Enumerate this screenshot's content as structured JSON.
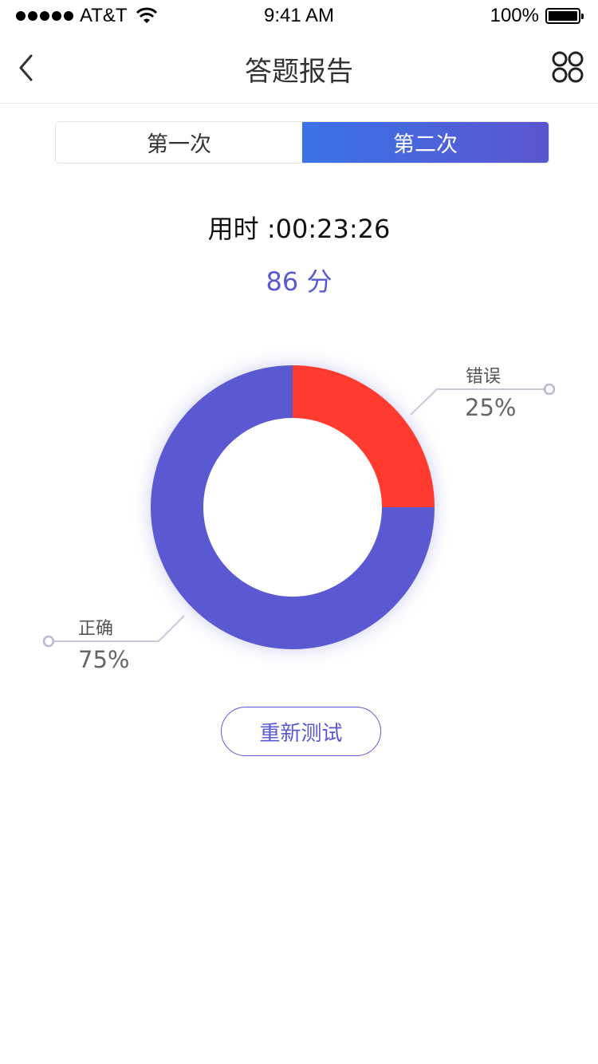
{
  "status_bar": {
    "carrier": "AT&T",
    "time": "9:41 AM",
    "battery": "100%"
  },
  "nav": {
    "title": "答题报告"
  },
  "tabs": [
    {
      "label": "第一次",
      "active": false
    },
    {
      "label": "第二次",
      "active": true
    }
  ],
  "result": {
    "time_text": "用时 :00:23:26",
    "score_text": "86 分"
  },
  "chart_data": {
    "type": "pie",
    "style": "donut",
    "slices": [
      {
        "label": "错误",
        "value": 25,
        "value_label": "25%",
        "color": "#ff3b30"
      },
      {
        "label": "正确",
        "value": 75,
        "value_label": "75%",
        "color": "#5a59d1"
      }
    ]
  },
  "actions": {
    "retest_label": "重新测试"
  },
  "colors": {
    "accent": "#5a59d1",
    "accent_gradient_start": "#3a73e6",
    "error": "#ff3b30"
  }
}
